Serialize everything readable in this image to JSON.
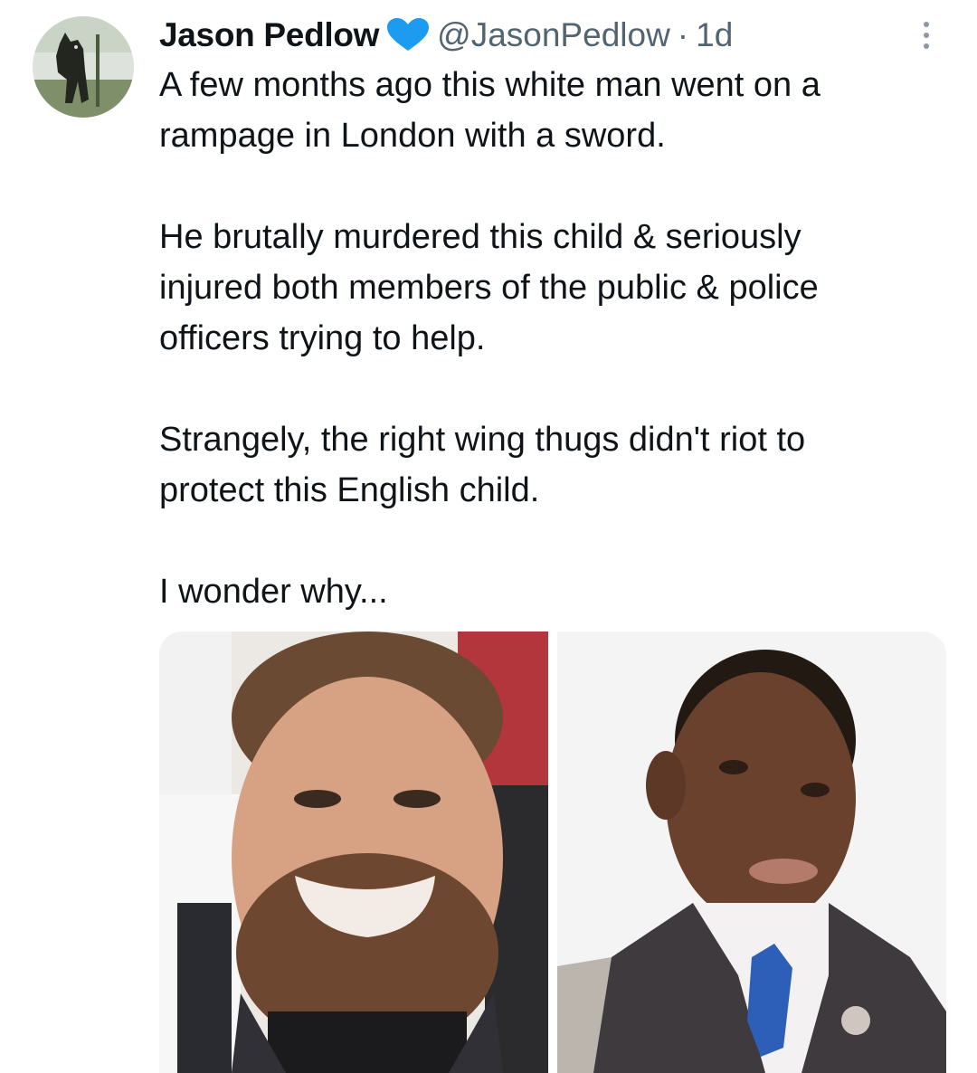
{
  "tweet": {
    "author": {
      "display_name": "Jason Pedlow",
      "verified_badge": "blue-heart-icon",
      "handle": "@JasonPedlow",
      "separator": "·",
      "time": "1d"
    },
    "body": {
      "paragraph_1": "A few months ago this white man went on a\nrampage in London with a sword.",
      "paragraph_2": "He brutally murdered this child & seriously\ninjured both members of the public & police\nofficers trying to help.",
      "paragraph_3": "Strangely, the right wing thugs didn't riot to\nprotect this English child.",
      "paragraph_4": "I wonder why..."
    },
    "media": {
      "count": 2
    },
    "colors": {
      "accent_heart": "#1d9bf0",
      "text_primary": "#0f1419",
      "text_secondary": "#536471"
    }
  }
}
